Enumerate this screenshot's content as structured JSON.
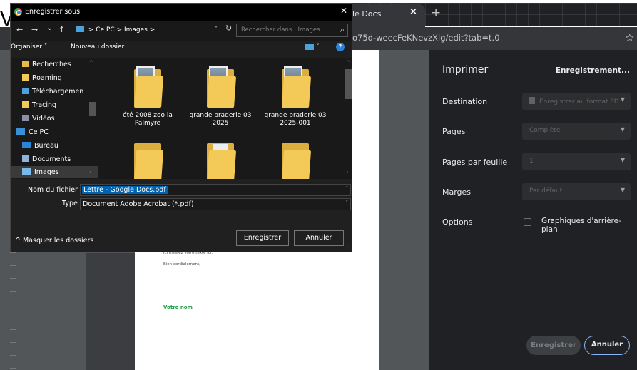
{
  "browser": {
    "tab_title": "le Docs",
    "tab_close": "×",
    "new_tab": "+",
    "url_fragment": "o75d-weecFeKNevzXlg/edit?tab=t.0",
    "star_icon": "☆",
    "background_letter": "V"
  },
  "page_preview": {
    "line1": "ici insérez votre texte ici.",
    "line2": "Bien cordialement,",
    "signature": "Votre nom",
    "signature_color": "#1e9e44"
  },
  "print_panel": {
    "title": "Imprimer",
    "sheets": "Enregistrement...",
    "destination_label": "Destination",
    "destination_value": "Enregistrer au format PD",
    "pages_label": "Pages",
    "pages_value": "Complète",
    "pages_per_sheet_label": "Pages par feuille",
    "pages_per_sheet_value": "1",
    "margins_label": "Marges",
    "margins_value": "Par défaut",
    "options_label": "Options",
    "background_graphics_label": "Graphiques d'arrière-plan",
    "save_button": "Enregistrer",
    "cancel_button": "Annuler",
    "accent_color": "#8ab4f8"
  },
  "dialog": {
    "title": "Enregistrer sous",
    "close": "✕",
    "nav": {
      "back": "←",
      "forward": "→",
      "recent": "⌄",
      "up": "↑"
    },
    "path": [
      "Ce PC",
      "Images"
    ],
    "path_separator": ">",
    "search_placeholder": "Rechercher dans : Images",
    "organize": "Organiser ˅",
    "new_folder": "Nouveau dossier",
    "help": "?",
    "nav_items": [
      {
        "label": "Recherches",
        "icon": "folder-icon",
        "color": "#e8b84a"
      },
      {
        "label": "Roaming",
        "icon": "folder-icon",
        "color": "#f3c957"
      },
      {
        "label": "Téléchargemen",
        "icon": "download-icon",
        "color": "#4aa3df"
      },
      {
        "label": "Tracing",
        "icon": "folder-icon",
        "color": "#f3c957"
      },
      {
        "label": "Vidéos",
        "icon": "video-icon",
        "color": "#8a8fa8"
      },
      {
        "label": "Ce PC",
        "icon": "pc-icon",
        "color": "#3a8fd9"
      },
      {
        "label": "Bureau",
        "icon": "desktop-icon",
        "color": "#2b84d6"
      },
      {
        "label": "Documents",
        "icon": "document-icon",
        "color": "#8fb4d9"
      },
      {
        "label": "Images",
        "icon": "images-icon",
        "color": "#7bb8e8"
      }
    ],
    "files": [
      {
        "name": "été 2008 zoo la Palmyre",
        "thumb": "photo"
      },
      {
        "name": "grande braderie 03 2025",
        "thumb": "photo"
      },
      {
        "name": "grande braderie 03 2025-001",
        "thumb": "photo"
      },
      {
        "name": "",
        "thumb": "empty"
      },
      {
        "name": "",
        "thumb": "doc"
      },
      {
        "name": "",
        "thumb": "empty"
      }
    ],
    "filename_label": "Nom du fichier :",
    "filename_value": "Lettre - Google Docs.pdf",
    "type_label": "Type :",
    "type_value": "Document Adobe Acrobat (*.pdf)",
    "hide_folders": "^ Masquer les dossiers",
    "save_button": "Enregistrer",
    "cancel_button": "Annuler",
    "selection_color": "#0063b1"
  }
}
